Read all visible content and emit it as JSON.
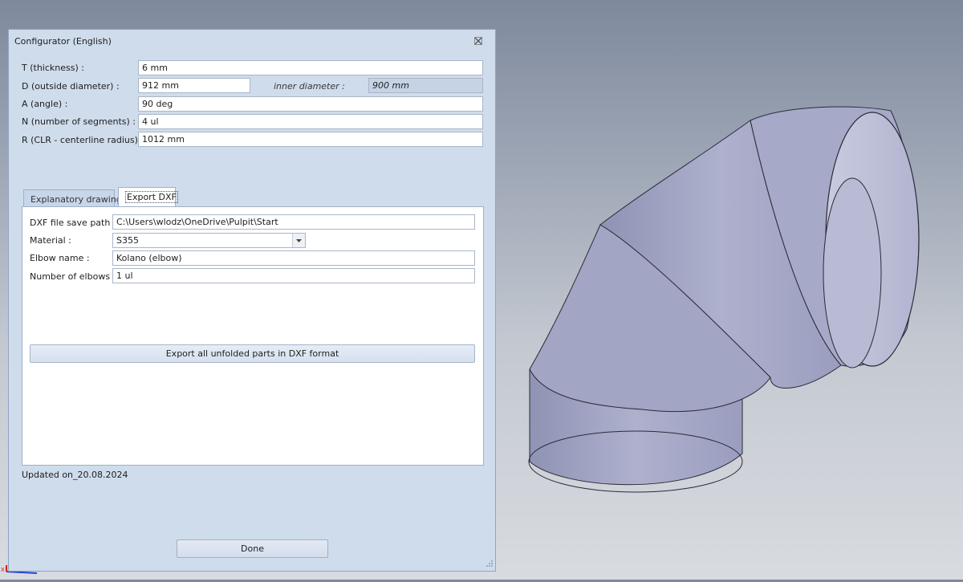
{
  "dialog": {
    "title": "Configurator (English)",
    "close_icon": "close-icon",
    "params": [
      {
        "key": "thickness",
        "label": "T  (thickness) :",
        "value": "6 mm"
      },
      {
        "key": "outside_diameter",
        "label": "D  (outside diameter) :",
        "value": "912 mm"
      },
      {
        "key": "angle",
        "label": "A  (angle) :",
        "value": "90 deg"
      },
      {
        "key": "segments",
        "label": "N  (number of segments)  :",
        "value": "4 ul"
      },
      {
        "key": "clr",
        "label": "R  (CLR - centerline radius) :",
        "value": "1012 mm"
      }
    ],
    "inner_diameter": {
      "label": "inner diameter :",
      "value": "900 mm"
    },
    "tabs": [
      {
        "label": "Explanatory drawing",
        "active": false
      },
      {
        "label": "Export DXF",
        "active": true
      }
    ],
    "export": {
      "save_path_label": "DXF file save path :",
      "save_path_value": "C:\\Users\\wlodz\\OneDrive\\Pulpit\\Start",
      "material_label": "Material :",
      "material_value": "S355",
      "elbow_name_label": "Elbow name :",
      "elbow_name_value": "Kolano (elbow)",
      "num_elbows_label": "Number of elbows :",
      "num_elbows_value": "1 ul",
      "export_button": "Export all unfolded parts in DXF format"
    },
    "updated": "Updated on_20.08.2024",
    "done_button": "Done"
  },
  "viewport": {
    "model": "elbow-pipe",
    "model_color": "#a6a9c8",
    "background_top": "#7e899c",
    "background_bottom": "#d8dbe0",
    "triad_x_label": "X"
  }
}
